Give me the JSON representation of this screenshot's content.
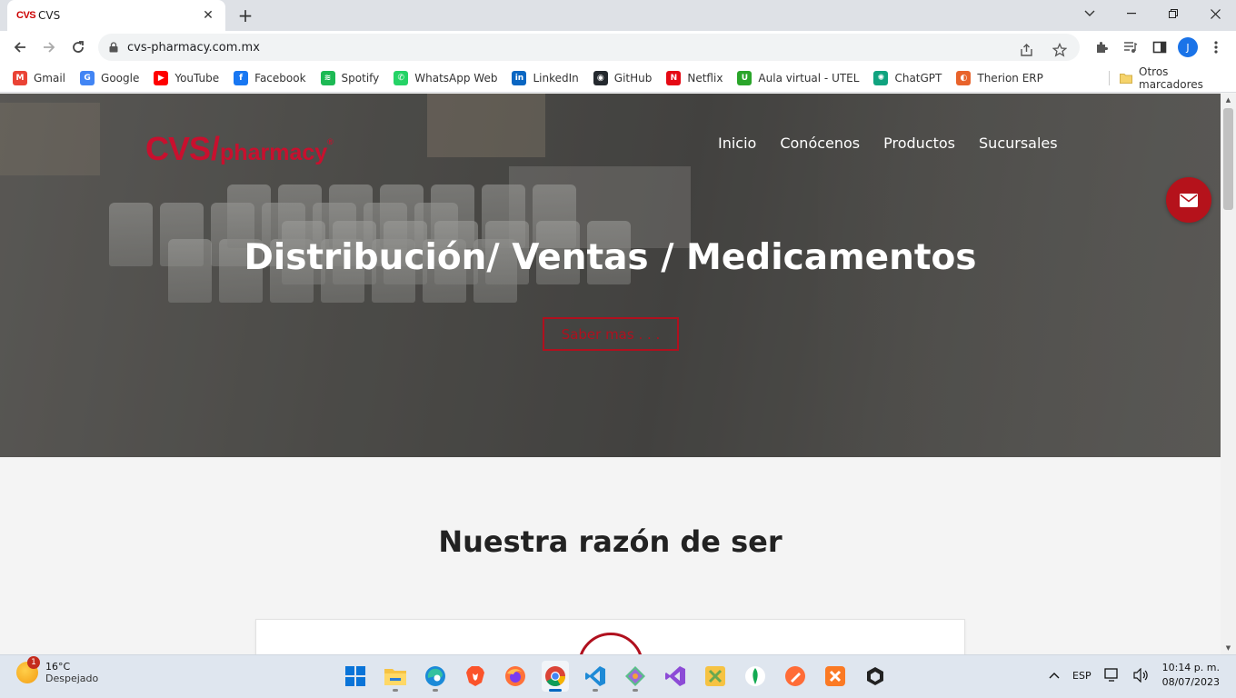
{
  "browser": {
    "tab_title": "CVS",
    "tab_favicon": "CVS",
    "url": "cvs-pharmacy.com.mx",
    "profile_initial": "J",
    "bookmarks": [
      {
        "label": "Gmail",
        "icon": "gmail-icon",
        "color": "#ea4335",
        "glyph": "M"
      },
      {
        "label": "Google",
        "icon": "google-icon",
        "color": "#4285f4",
        "glyph": "G"
      },
      {
        "label": "YouTube",
        "icon": "youtube-icon",
        "color": "#ff0000",
        "glyph": "▶"
      },
      {
        "label": "Facebook",
        "icon": "facebook-icon",
        "color": "#1877f2",
        "glyph": "f"
      },
      {
        "label": "Spotify",
        "icon": "spotify-icon",
        "color": "#1db954",
        "glyph": "≋"
      },
      {
        "label": "WhatsApp Web",
        "icon": "whatsapp-icon",
        "color": "#25d366",
        "glyph": "✆"
      },
      {
        "label": "LinkedIn",
        "icon": "linkedin-icon",
        "color": "#0a66c2",
        "glyph": "in"
      },
      {
        "label": "GitHub",
        "icon": "github-icon",
        "color": "#24292e",
        "glyph": "◉"
      },
      {
        "label": "Netflix",
        "icon": "netflix-icon",
        "color": "#e50914",
        "glyph": "N"
      },
      {
        "label": "Aula virtual - UTEL",
        "icon": "utel-icon",
        "color": "#2aa52a",
        "glyph": "U"
      },
      {
        "label": "ChatGPT",
        "icon": "chatgpt-icon",
        "color": "#10a37f",
        "glyph": "✺"
      },
      {
        "label": "Therion ERP",
        "icon": "therion-icon",
        "color": "#e8632b",
        "glyph": "◐"
      }
    ],
    "other_bookmarks": "Otros marcadores"
  },
  "site": {
    "logo_cvs": "CVS",
    "logo_slash": "/",
    "logo_pharmacy": "pharmacy",
    "logo_reg": "®",
    "nav": [
      "Inicio",
      "Conócenos",
      "Productos",
      "Sucursales"
    ],
    "hero_title": "Distribución/ Ventas / Medicamentos",
    "hero_button": "Saber mas . . .",
    "section_title": "Nuestra razón de ser",
    "accent_color": "#b5121b"
  },
  "taskbar": {
    "weather_temp": "16°C",
    "weather_desc": "Despejado",
    "weather_badge": "1",
    "apps": [
      "start-icon",
      "file-explorer-icon",
      "edge-icon",
      "brave-icon",
      "firefox-icon",
      "chrome-icon",
      "vscode-icon",
      "git-icon",
      "visual-studio-icon",
      "xampp-icon",
      "mongodb-icon",
      "postman-icon",
      "xampp-control-icon",
      "unity-icon"
    ],
    "language": "ESP",
    "time": "10:14 p. m.",
    "date": "08/07/2023"
  }
}
